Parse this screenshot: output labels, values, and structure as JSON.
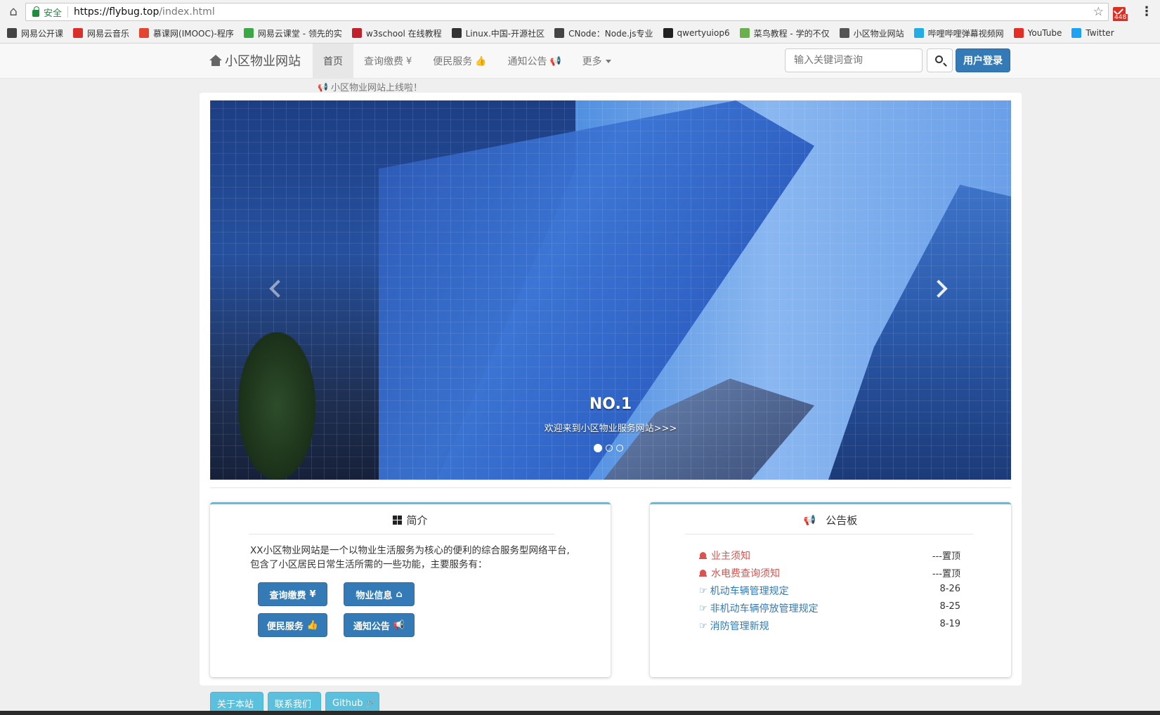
{
  "browser": {
    "secure_label": "安全",
    "url_host": "https://flybug.top",
    "url_path": "/index.html",
    "mail_badge": "448",
    "bookmarks": [
      {
        "label": "网易公开课",
        "icon": "book-icon",
        "color": "#444"
      },
      {
        "label": "网易云音乐",
        "icon": "netease-music-icon",
        "color": "#d8302a"
      },
      {
        "label": "慕课网(IMOOC)-程序",
        "icon": "flame-icon",
        "color": "#e4452f"
      },
      {
        "label": "网易云课堂 - 领先的实",
        "icon": "study-icon",
        "color": "#3ba845"
      },
      {
        "label": "w3school 在线教程",
        "icon": "w3-icon",
        "color": "#c0222b"
      },
      {
        "label": "Linux.中国-开源社区",
        "icon": "linux-icon",
        "color": "#333"
      },
      {
        "label": "CNode：Node.js专业",
        "icon": "cnode-icon",
        "color": "#444"
      },
      {
        "label": "qwertyuiop6",
        "icon": "github-icon",
        "color": "#222"
      },
      {
        "label": "菜鸟教程 - 学的不仅",
        "icon": "runoob-icon",
        "color": "#6ab04c"
      },
      {
        "label": "小区物业网站",
        "icon": "home-icon",
        "color": "#555"
      },
      {
        "label": "哔哩哔哩弹幕视频网",
        "icon": "bilibili-icon",
        "color": "#23ade5"
      },
      {
        "label": "YouTube",
        "icon": "youtube-icon",
        "color": "#e52d27"
      },
      {
        "label": "Twitter",
        "icon": "twitter-icon",
        "color": "#1da1f2"
      }
    ]
  },
  "navbar": {
    "brand": "小区物业网站",
    "items": [
      {
        "label": "首页",
        "icon": "",
        "active": true
      },
      {
        "label": "查询缴费",
        "icon": "¥"
      },
      {
        "label": "便民服务",
        "icon": "👍"
      },
      {
        "label": "通知公告",
        "icon": "📢"
      },
      {
        "label": "更多",
        "icon": "caret"
      }
    ],
    "search_placeholder": "输入关键词查询",
    "login_label": "用户登录"
  },
  "marquee": "小区物业网站上线啦！",
  "carousel": {
    "title": "NO.1",
    "subtitle": "欢迎来到小区物业服务网站>>>",
    "slide_count": 3,
    "active_index": 0
  },
  "intro": {
    "heading": "简介",
    "text": "XX小区物业网站是一个以物业生活服务为核心的便利的综合服务型网络平台,包含了小区居民日常生活所需的一些功能，主要服务有：",
    "buttons": [
      {
        "label": "查询缴费",
        "icon": "¥"
      },
      {
        "label": "物业信息",
        "icon": "⌂"
      },
      {
        "label": "便民服务",
        "icon": "👍"
      },
      {
        "label": "通知公告",
        "icon": "📢"
      }
    ]
  },
  "board": {
    "heading": "公告板",
    "notices": [
      {
        "title": "业主须知",
        "tag": "---置顶",
        "type": "pinned"
      },
      {
        "title": "水电费查询须知",
        "tag": "---置顶",
        "type": "pinned"
      },
      {
        "title": "机动车辆管理规定",
        "tag": "8-26",
        "type": "normal"
      },
      {
        "title": "非机动车辆停放管理规定",
        "tag": "8-25",
        "type": "normal"
      },
      {
        "title": "消防管理新规",
        "tag": "8-19",
        "type": "normal"
      }
    ]
  },
  "footer": {
    "about": "关于本站",
    "contact": "联系我们",
    "github": "Github"
  },
  "colors": {
    "primary": "#337ab7",
    "info": "#5bc0de",
    "danger": "#d9534f"
  }
}
